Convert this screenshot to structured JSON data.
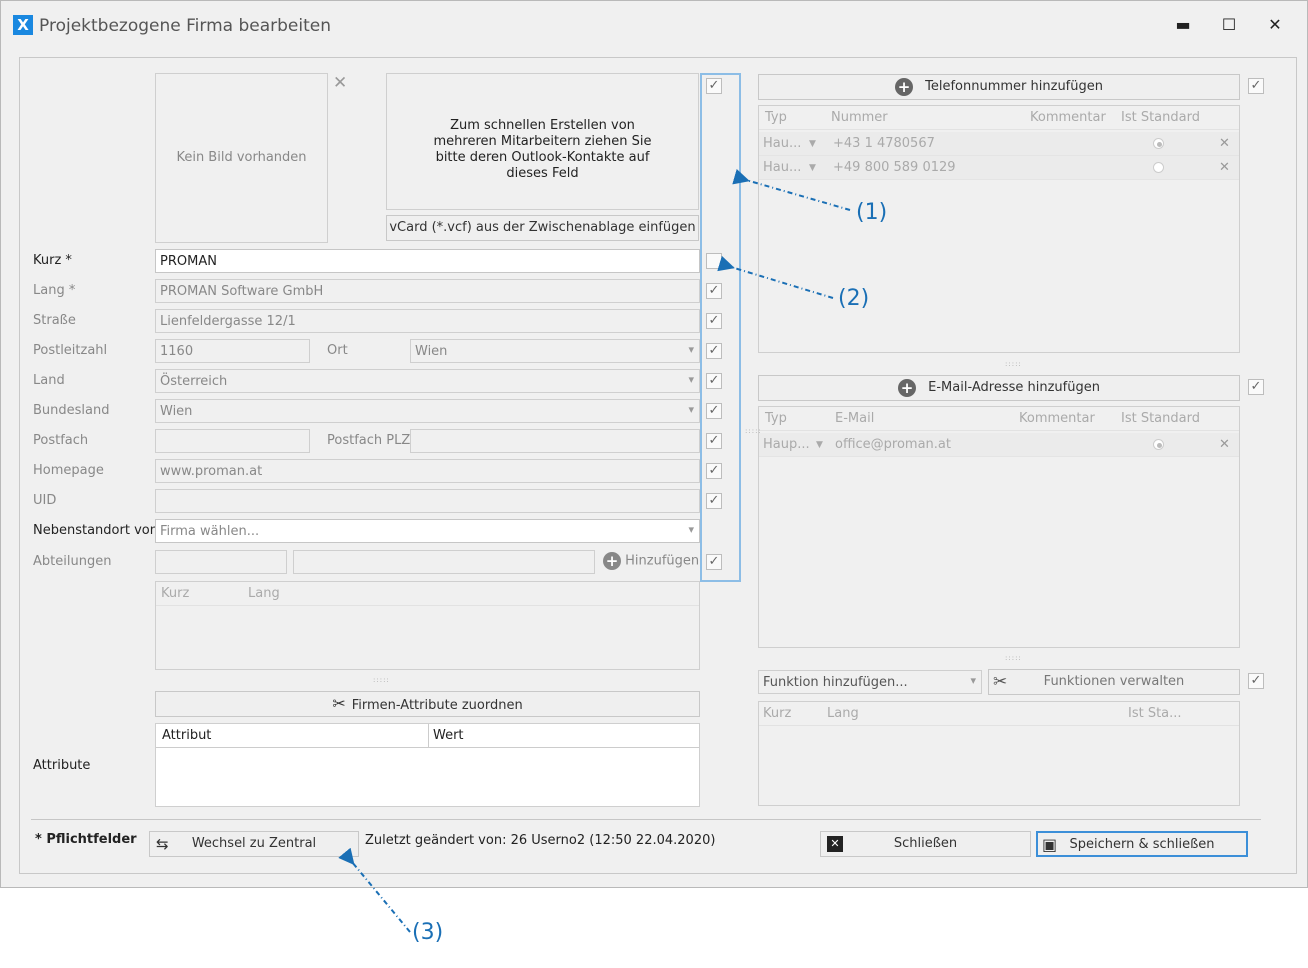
{
  "window": {
    "title": "Projektbezogene Firma bearbeiten",
    "app_icon": "X",
    "minimize": "▬",
    "maximize": "☐",
    "close": "✕"
  },
  "image": {
    "no_image": "Kein Bild vorhanden",
    "remove": "✕"
  },
  "outlook_drop": "Zum schnellen Erstellen von mehreren Mitarbeitern ziehen Sie bitte deren Outlook-Kontakte auf dieses Feld",
  "vcard_button": "vCard (*.vcf) aus der Zwischenablage einfügen",
  "form": {
    "kurz_label": "Kurz *",
    "kurz_value": "PROMAN",
    "lang_label": "Lang *",
    "lang_value": "PROMAN Software GmbH",
    "strasse_label": "Straße",
    "strasse_value": "Lienfeldergasse 12/1",
    "plz_label": "Postleitzahl",
    "plz_value": "1160",
    "ort_label": "Ort",
    "ort_value": "Wien",
    "land_label": "Land",
    "land_value": "Österreich",
    "bundesland_label": "Bundesland",
    "bundesland_value": "Wien",
    "postfach_label": "Postfach",
    "postfach_value": "",
    "postfach_plz_label": "Postfach PLZ",
    "postfach_plz_value": "",
    "homepage_label": "Homepage",
    "homepage_value": "www.proman.at",
    "uid_label": "UID",
    "uid_value": "",
    "nebenstandort_label": "Nebenstandort von",
    "nebenstandort_placeholder": "Firma wählen...",
    "abteilungen_label": "Abteilungen",
    "abteilungen_add": "Hinzufügen"
  },
  "abteilungen_grid": {
    "col_kurz": "Kurz",
    "col_lang": "Lang"
  },
  "attribute": {
    "button": "Firmen-Attribute zuordnen",
    "col_attribut": "Attribut",
    "col_wert": "Wert",
    "label": "Attribute"
  },
  "phone": {
    "add_button": "Telefonnummer hinzufügen",
    "headers": [
      "Typ",
      "Nummer",
      "Kommentar",
      "Ist Standard"
    ],
    "rows": [
      {
        "typ": "Hau...",
        "nummer": "+43 1 4780567",
        "kommentar": ""
      },
      {
        "typ": "Hau...",
        "nummer": "+49 800 589 0129",
        "kommentar": ""
      }
    ]
  },
  "email": {
    "add_button": "E-Mail-Adresse hinzufügen",
    "headers": [
      "Typ",
      "E-Mail",
      "Kommentar",
      "Ist Standard"
    ],
    "rows": [
      {
        "typ": "Haup...",
        "email": "office@proman.at",
        "kommentar": ""
      }
    ]
  },
  "funktion": {
    "placeholder": "Funktion hinzufügen...",
    "manage_button": "Funktionen verwalten",
    "headers": [
      "Kurz",
      "Lang",
      "Ist Sta..."
    ]
  },
  "footer": {
    "required": "* Pflichtfelder",
    "switch_button": "Wechsel zu Zentral",
    "last_changed": "Zuletzt geändert von: 26 Userno2 (12:50 22.04.2020)",
    "close_button": "Schließen",
    "save_button": "Speichern & schließen"
  },
  "annotations": [
    "(1)",
    "(2)",
    "(3)"
  ],
  "colors": {
    "accent": "#1a88e0",
    "annotation": "#1a6fb5",
    "highlight_border": "#8cbde6"
  }
}
